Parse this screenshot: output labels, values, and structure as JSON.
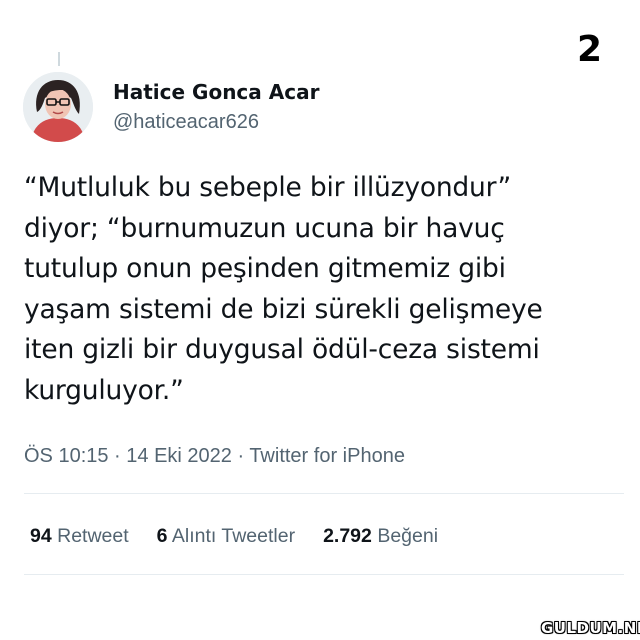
{
  "page_number": "2",
  "author": {
    "name": "Hatice Gonca Acar",
    "handle": "@haticeacar626",
    "avatar_icon": "profile-photo-avatar"
  },
  "tweet": {
    "lines": [
      "“Mutluluk bu sebeple bir illüzyondur”",
      "diyor; “burnumuzun ucuna bir havuç",
      "tutulup onun peşinden gitmemiz gibi",
      "yaşam sistemi de bizi sürekli gelişmeye",
      "iten gizli bir duygusal ödül-ceza sistemi",
      "kurguluyor.”"
    ],
    "meta": "ÖS 10:15 · 14 Eki 2022 · Twitter for iPhone"
  },
  "stats": {
    "retweets": {
      "count": "94",
      "label": "Retweet"
    },
    "quotes": {
      "count": "6",
      "label": "Alıntı Tweetler"
    },
    "likes": {
      "count": "2.792",
      "label": "Beğeni"
    }
  },
  "watermark": "GULDUM.NET",
  "colors": {
    "text": "#0f1419",
    "secondary": "#536471",
    "divider": "#e6ecf0"
  }
}
